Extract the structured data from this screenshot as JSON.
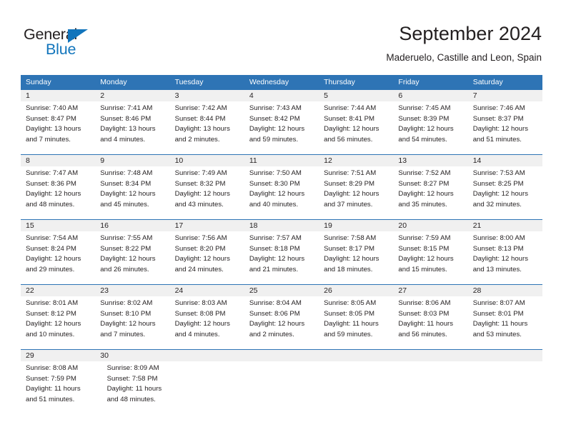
{
  "brand": {
    "name_part1": "General",
    "name_part2": "Blue",
    "triangle_color": "#1275bc",
    "text_color": "#231f20"
  },
  "header": {
    "title": "September 2024",
    "subtitle": "Maderuelo, Castille and Leon, Spain"
  },
  "theme": {
    "header_blue": "#2e74b5",
    "daynum_band": "#f0f0f0",
    "text": "#231f20",
    "white": "#ffffff"
  },
  "calendar": {
    "weekdays": [
      "Sunday",
      "Monday",
      "Tuesday",
      "Wednesday",
      "Thursday",
      "Friday",
      "Saturday"
    ],
    "weeks": [
      [
        {
          "day": "1",
          "sunrise": "Sunrise: 7:40 AM",
          "sunset": "Sunset: 8:47 PM",
          "daylight_line1": "Daylight: 13 hours",
          "daylight_line2": "and 7 minutes."
        },
        {
          "day": "2",
          "sunrise": "Sunrise: 7:41 AM",
          "sunset": "Sunset: 8:46 PM",
          "daylight_line1": "Daylight: 13 hours",
          "daylight_line2": "and 4 minutes."
        },
        {
          "day": "3",
          "sunrise": "Sunrise: 7:42 AM",
          "sunset": "Sunset: 8:44 PM",
          "daylight_line1": "Daylight: 13 hours",
          "daylight_line2": "and 2 minutes."
        },
        {
          "day": "4",
          "sunrise": "Sunrise: 7:43 AM",
          "sunset": "Sunset: 8:42 PM",
          "daylight_line1": "Daylight: 12 hours",
          "daylight_line2": "and 59 minutes."
        },
        {
          "day": "5",
          "sunrise": "Sunrise: 7:44 AM",
          "sunset": "Sunset: 8:41 PM",
          "daylight_line1": "Daylight: 12 hours",
          "daylight_line2": "and 56 minutes."
        },
        {
          "day": "6",
          "sunrise": "Sunrise: 7:45 AM",
          "sunset": "Sunset: 8:39 PM",
          "daylight_line1": "Daylight: 12 hours",
          "daylight_line2": "and 54 minutes."
        },
        {
          "day": "7",
          "sunrise": "Sunrise: 7:46 AM",
          "sunset": "Sunset: 8:37 PM",
          "daylight_line1": "Daylight: 12 hours",
          "daylight_line2": "and 51 minutes."
        }
      ],
      [
        {
          "day": "8",
          "sunrise": "Sunrise: 7:47 AM",
          "sunset": "Sunset: 8:36 PM",
          "daylight_line1": "Daylight: 12 hours",
          "daylight_line2": "and 48 minutes."
        },
        {
          "day": "9",
          "sunrise": "Sunrise: 7:48 AM",
          "sunset": "Sunset: 8:34 PM",
          "daylight_line1": "Daylight: 12 hours",
          "daylight_line2": "and 45 minutes."
        },
        {
          "day": "10",
          "sunrise": "Sunrise: 7:49 AM",
          "sunset": "Sunset: 8:32 PM",
          "daylight_line1": "Daylight: 12 hours",
          "daylight_line2": "and 43 minutes."
        },
        {
          "day": "11",
          "sunrise": "Sunrise: 7:50 AM",
          "sunset": "Sunset: 8:30 PM",
          "daylight_line1": "Daylight: 12 hours",
          "daylight_line2": "and 40 minutes."
        },
        {
          "day": "12",
          "sunrise": "Sunrise: 7:51 AM",
          "sunset": "Sunset: 8:29 PM",
          "daylight_line1": "Daylight: 12 hours",
          "daylight_line2": "and 37 minutes."
        },
        {
          "day": "13",
          "sunrise": "Sunrise: 7:52 AM",
          "sunset": "Sunset: 8:27 PM",
          "daylight_line1": "Daylight: 12 hours",
          "daylight_line2": "and 35 minutes."
        },
        {
          "day": "14",
          "sunrise": "Sunrise: 7:53 AM",
          "sunset": "Sunset: 8:25 PM",
          "daylight_line1": "Daylight: 12 hours",
          "daylight_line2": "and 32 minutes."
        }
      ],
      [
        {
          "day": "15",
          "sunrise": "Sunrise: 7:54 AM",
          "sunset": "Sunset: 8:24 PM",
          "daylight_line1": "Daylight: 12 hours",
          "daylight_line2": "and 29 minutes."
        },
        {
          "day": "16",
          "sunrise": "Sunrise: 7:55 AM",
          "sunset": "Sunset: 8:22 PM",
          "daylight_line1": "Daylight: 12 hours",
          "daylight_line2": "and 26 minutes."
        },
        {
          "day": "17",
          "sunrise": "Sunrise: 7:56 AM",
          "sunset": "Sunset: 8:20 PM",
          "daylight_line1": "Daylight: 12 hours",
          "daylight_line2": "and 24 minutes."
        },
        {
          "day": "18",
          "sunrise": "Sunrise: 7:57 AM",
          "sunset": "Sunset: 8:18 PM",
          "daylight_line1": "Daylight: 12 hours",
          "daylight_line2": "and 21 minutes."
        },
        {
          "day": "19",
          "sunrise": "Sunrise: 7:58 AM",
          "sunset": "Sunset: 8:17 PM",
          "daylight_line1": "Daylight: 12 hours",
          "daylight_line2": "and 18 minutes."
        },
        {
          "day": "20",
          "sunrise": "Sunrise: 7:59 AM",
          "sunset": "Sunset: 8:15 PM",
          "daylight_line1": "Daylight: 12 hours",
          "daylight_line2": "and 15 minutes."
        },
        {
          "day": "21",
          "sunrise": "Sunrise: 8:00 AM",
          "sunset": "Sunset: 8:13 PM",
          "daylight_line1": "Daylight: 12 hours",
          "daylight_line2": "and 13 minutes."
        }
      ],
      [
        {
          "day": "22",
          "sunrise": "Sunrise: 8:01 AM",
          "sunset": "Sunset: 8:12 PM",
          "daylight_line1": "Daylight: 12 hours",
          "daylight_line2": "and 10 minutes."
        },
        {
          "day": "23",
          "sunrise": "Sunrise: 8:02 AM",
          "sunset": "Sunset: 8:10 PM",
          "daylight_line1": "Daylight: 12 hours",
          "daylight_line2": "and 7 minutes."
        },
        {
          "day": "24",
          "sunrise": "Sunrise: 8:03 AM",
          "sunset": "Sunset: 8:08 PM",
          "daylight_line1": "Daylight: 12 hours",
          "daylight_line2": "and 4 minutes."
        },
        {
          "day": "25",
          "sunrise": "Sunrise: 8:04 AM",
          "sunset": "Sunset: 8:06 PM",
          "daylight_line1": "Daylight: 12 hours",
          "daylight_line2": "and 2 minutes."
        },
        {
          "day": "26",
          "sunrise": "Sunrise: 8:05 AM",
          "sunset": "Sunset: 8:05 PM",
          "daylight_line1": "Daylight: 11 hours",
          "daylight_line2": "and 59 minutes."
        },
        {
          "day": "27",
          "sunrise": "Sunrise: 8:06 AM",
          "sunset": "Sunset: 8:03 PM",
          "daylight_line1": "Daylight: 11 hours",
          "daylight_line2": "and 56 minutes."
        },
        {
          "day": "28",
          "sunrise": "Sunrise: 8:07 AM",
          "sunset": "Sunset: 8:01 PM",
          "daylight_line1": "Daylight: 11 hours",
          "daylight_line2": "and 53 minutes."
        }
      ],
      [
        {
          "day": "29",
          "sunrise": "Sunrise: 8:08 AM",
          "sunset": "Sunset: 7:59 PM",
          "daylight_line1": "Daylight: 11 hours",
          "daylight_line2": "and 51 minutes."
        },
        {
          "day": "30",
          "sunrise": "Sunrise: 8:09 AM",
          "sunset": "Sunset: 7:58 PM",
          "daylight_line1": "Daylight: 11 hours",
          "daylight_line2": "and 48 minutes."
        },
        {
          "day": "",
          "sunrise": "",
          "sunset": "",
          "daylight_line1": "",
          "daylight_line2": ""
        },
        {
          "day": "",
          "sunrise": "",
          "sunset": "",
          "daylight_line1": "",
          "daylight_line2": ""
        },
        {
          "day": "",
          "sunrise": "",
          "sunset": "",
          "daylight_line1": "",
          "daylight_line2": ""
        },
        {
          "day": "",
          "sunrise": "",
          "sunset": "",
          "daylight_line1": "",
          "daylight_line2": ""
        },
        {
          "day": "",
          "sunrise": "",
          "sunset": "",
          "daylight_line1": "",
          "daylight_line2": ""
        }
      ]
    ]
  }
}
